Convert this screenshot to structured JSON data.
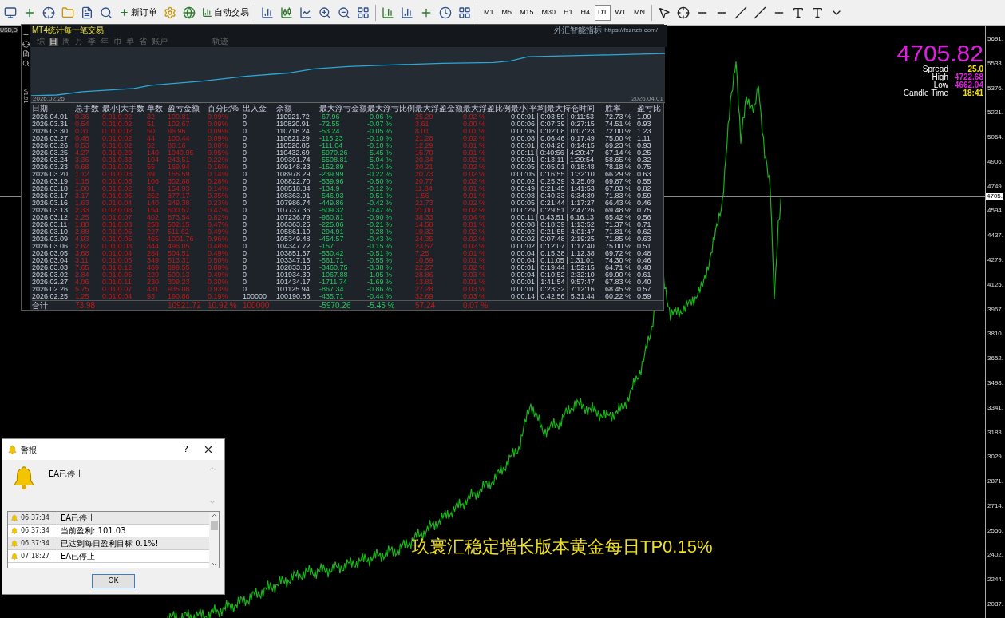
{
  "toolbar": {
    "new_order": "新订单",
    "auto_trading": "自动交易",
    "timeframes": [
      {
        "label": "M1",
        "selected": false
      },
      {
        "label": "M5",
        "selected": false
      },
      {
        "label": "M15",
        "selected": false
      },
      {
        "label": "M30",
        "selected": false
      },
      {
        "label": "H1",
        "selected": false
      },
      {
        "label": "H4",
        "selected": false
      },
      {
        "label": "D1",
        "selected": true
      },
      {
        "label": "W1",
        "selected": false
      },
      {
        "label": "MN",
        "selected": false
      }
    ]
  },
  "chart": {
    "symbol_tab": "USD,D",
    "price_labels": [
      "5691.",
      "5533.",
      "5376.",
      "5221.",
      "5064.",
      "4906.",
      "4749.",
      "4594.",
      "4437.",
      "4279.",
      "4125.",
      "3967.",
      "3810.",
      "3652.",
      "3498.",
      "3341.",
      "3183.",
      "3029.",
      "2871.",
      "2714.",
      "2556.",
      "2402.",
      "2244.",
      "2087."
    ],
    "current_price_label": "4705.",
    "price": "4705.82",
    "info": [
      {
        "label": "Spread",
        "value": "25.0",
        "color": "#f5e100"
      },
      {
        "label": "High",
        "value": "4722.68",
        "color": "#e020e0"
      },
      {
        "label": "Low",
        "value": "4662.04",
        "color": "#e020e0"
      },
      {
        "label": "Candle Time",
        "value": "18:41",
        "color": "#f5e100"
      }
    ],
    "caption": "玖寰汇稳定增长版本黄金每日TP0.15%"
  },
  "stats_panel": {
    "title": "MT4统计每一笔交易",
    "brand": "外汇智能指标",
    "url": "https://fxznzb.com/",
    "version": "V1.91",
    "tabs": [
      {
        "label": "综",
        "selected": false
      },
      {
        "label": "日",
        "selected": true
      },
      {
        "label": "周",
        "selected": false
      },
      {
        "label": "月",
        "selected": false
      },
      {
        "label": "季",
        "selected": false
      },
      {
        "label": "年",
        "selected": false
      },
      {
        "label": "币",
        "selected": false
      },
      {
        "label": "单",
        "selected": false
      },
      {
        "label": "省",
        "selected": false
      },
      {
        "label": "账户",
        "selected": false
      },
      {
        "label": "轨迹",
        "selected": false
      }
    ],
    "equity_start": "2026.02.25",
    "equity_end": "2026.04.01",
    "columns": [
      {
        "label": "日期",
        "kind": "plain"
      },
      {
        "label": "总手数",
        "kind": "red"
      },
      {
        "label": "最小|大手数",
        "kind": "red"
      },
      {
        "label": "单数",
        "kind": "red"
      },
      {
        "label": "盈亏金额",
        "kind": "red"
      },
      {
        "label": "百分比%",
        "kind": "red"
      },
      {
        "label": "出入金",
        "kind": "plain"
      },
      {
        "label": "余额",
        "kind": "plain"
      },
      {
        "label": "最大浮亏金额",
        "kind": "green"
      },
      {
        "label": "最大浮亏比例",
        "kind": "green"
      },
      {
        "label": "最大浮盈金额",
        "kind": "red"
      },
      {
        "label": "最大浮盈比例",
        "kind": "red"
      },
      {
        "label": "最小|平均|最大持仓时间",
        "kind": "plain"
      },
      {
        "label": "胜率",
        "kind": "plain"
      },
      {
        "label": "盈亏比",
        "kind": "plain"
      }
    ],
    "rows": [
      [
        "2026.04.01",
        "0.36",
        "0.01|0.02",
        "32",
        "100.81",
        "0.09%",
        "0",
        "110921.72",
        "-67.96",
        "-0.06 %",
        "25.29",
        "0.02 %",
        "0:00:01 | 0:03:59 | 0:11:53",
        "72.73 %",
        "1.09"
      ],
      [
        "2026.03.31",
        "0.54",
        "0.01|0.02",
        "51",
        "102.67",
        "0.09%",
        "0",
        "110820.91",
        "-72.55",
        "-0.07 %",
        "3.61",
        "0.00 %",
        "0:00:06 | 0:07:39 | 0:27:15",
        "74.51 %",
        "0.93"
      ],
      [
        "2026.03.30",
        "0.31",
        "0.01|0.02",
        "50",
        "96.96",
        "0.09%",
        "0",
        "110718.24",
        "-53.24",
        "-0.05 %",
        "8.01",
        "0.01 %",
        "0:00:06 | 0:02:08 | 0:07:23",
        "72.00 %",
        "1.23"
      ],
      [
        "2026.03.27",
        "0.48",
        "0.01|0.02",
        "44",
        "100.44",
        "0.09%",
        "0",
        "110621.29",
        "-115.23",
        "-0.10 %",
        "21.28",
        "0.02 %",
        "0:00:08 | 0:06:46 | 0:17:49",
        "75.00 %",
        "1.11"
      ],
      [
        "2026.03.26",
        "0.53",
        "0.01|0.02",
        "52",
        "88.16",
        "0.08%",
        "0",
        "110520.85",
        "-111.04",
        "-0.10 %",
        "12.29",
        "0.01 %",
        "0:00:01 | 0:04:26 | 0:14:15",
        "69.23 %",
        "0.93"
      ],
      [
        "2026.03.25",
        "4.27",
        "0.01|0.29",
        "140",
        "1040.95",
        "0.95%",
        "0",
        "110432.69",
        "-5970.26",
        "-5.45 %",
        "15.70",
        "0.01 %",
        "0:00:11 | 0:40:56 | 4:20:47",
        "67.14 %",
        "0.25"
      ],
      [
        "2026.03.24",
        "3.36",
        "0.01|0.33",
        "104",
        "243.51",
        "0.22%",
        "0",
        "109391.74",
        "-5508.81",
        "-5.04 %",
        "20.34",
        "0.02 %",
        "0:00:01 | 0:13:11 | 1:29:54",
        "58.65 %",
        "0.32"
      ],
      [
        "2026.03.23",
        "0.68",
        "0.01|0.02",
        "55",
        "169.94",
        "0.16%",
        "0",
        "109148.23",
        "-152.89",
        "-0.14 %",
        "20.21",
        "0.02 %",
        "0:00:05 | 0:05:01 | 0:18:48",
        "78.18 %",
        "0.75"
      ],
      [
        "2026.03.20",
        "1.12",
        "0.01|0.03",
        "89",
        "155.59",
        "0.14%",
        "0",
        "108978.29",
        "-239.99",
        "-0.22 %",
        "20.73",
        "0.02 %",
        "0:00:05 | 0:16:55 | 1:32:10",
        "66.29 %",
        "0.63"
      ],
      [
        "2026.03.19",
        "1.15",
        "0.01|0.05",
        "106",
        "302.88",
        "0.28%",
        "0",
        "108822.70",
        "-539.96",
        "-0.50 %",
        "20.77",
        "0.02 %",
        "0:00:02 | 0:25:39 | 3:25:09",
        "69.87 %",
        "0.55"
      ],
      [
        "2026.03.18",
        "1.00",
        "0.01|0.02",
        "91",
        "154.93",
        "0.14%",
        "0",
        "108518.84",
        "-134.9",
        "-0.12 %",
        "11.84",
        "0.01 %",
        "0:00:49 | 0:21:45 | 1:41:53",
        "67.03 %",
        "0.82"
      ],
      [
        "2026.03.17",
        "3.17",
        "0.01|0.05",
        "252",
        "377.17",
        "0.35%",
        "0",
        "108363.91",
        "-546.93",
        "-0.51 %",
        "1.56",
        "0.01 %",
        "0:00:08 | 0:40:33 | 6:34:39",
        "71.83 %",
        "0.59"
      ],
      [
        "2026.03.16",
        "1.63",
        "0.01|0.04",
        "140",
        "249.38",
        "0.23%",
        "0",
        "107986.74",
        "-449.86",
        "-0.42 %",
        "22.73",
        "0.02 %",
        "0:00:05 | 0:21:44 | 1:17:27",
        "66.43 %",
        "0.46"
      ],
      [
        "2026.03.13",
        "2.33",
        "0.02|0.08",
        "154",
        "500.57",
        "0.47%",
        "0",
        "107737.36",
        "-509.32",
        "-0.47 %",
        "21.00",
        "0.02 %",
        "0:00:29 | 0:29:51 | 2:47:26",
        "69.48 %",
        "0.75"
      ],
      [
        "2026.03.12",
        "2.25",
        "0.01|0.07",
        "402",
        "873.54",
        "0.82%",
        "0",
        "107236.79",
        "-960.81",
        "-0.90 %",
        "38.33",
        "0.04 %",
        "0:00:11 | 0:43:51 | 6:16:13",
        "65.42 %",
        "0.56"
      ],
      [
        "2026.03.11",
        "1.80",
        "0.01|0.03",
        "258",
        "502.15",
        "0.47%",
        "0",
        "106363.25",
        "-225.06",
        "-0.21 %",
        "14.58",
        "0.01 %",
        "0:00:08 | 0:18:39 | 1:13:52",
        "71.37 %",
        "0.71"
      ],
      [
        "2026.03.10",
        "2.88",
        "0.01|0.05",
        "227",
        "511.62",
        "0.49%",
        "0",
        "105861.10",
        "-294.91",
        "-0.28 %",
        "19.32",
        "0.02 %",
        "0:00:02 | 0:21:55 | 4:01:47",
        "71.81 %",
        "0.62"
      ],
      [
        "2026.03.09",
        "4.93",
        "0.01|0.05",
        "465",
        "1001.76",
        "0.96%",
        "0",
        "105349.48",
        "-454.57",
        "-0.43 %",
        "24.35",
        "0.02 %",
        "0:00:02 | 0:07:48 | 2:19:25",
        "71.85 %",
        "0.63"
      ],
      [
        "2026.03.06",
        "2.62",
        "0.01|0.03",
        "344",
        "496.05",
        "0.48%",
        "0",
        "104347.72",
        "-157",
        "-0.15 %",
        "23.57",
        "0.02 %",
        "0:00:02 | 0:12:07 | 1:17:40",
        "75.00 %",
        "0.51"
      ],
      [
        "2026.03.05",
        "3.68",
        "0.01|0.04",
        "284",
        "504.51",
        "0.49%",
        "0",
        "103851.67",
        "-530.42",
        "-0.51 %",
        "7.25",
        "0.01 %",
        "0:00:04 | 0:15:38 | 1:12:38",
        "69.72 %",
        "0.48"
      ],
      [
        "2026.03.04",
        "3.11",
        "0.01|0.05",
        "349",
        "513.31",
        "0.50%",
        "0",
        "103347.16",
        "-561.71",
        "-0.55 %",
        "10.59",
        "0.01 %",
        "0:00:04 | 0:11:05 | 1:31:01",
        "74.30 %",
        "0.46"
      ],
      [
        "2026.03.03",
        "7.65",
        "0.01|0.12",
        "469",
        "899.55",
        "0.88%",
        "0",
        "102833.85",
        "-3460.75",
        "-3.38 %",
        "22.27",
        "0.02 %",
        "0:00:01 | 0:19:44 | 1:52:15",
        "64.71 %",
        "0.40"
      ],
      [
        "2026.03.02",
        "2.84",
        "0.01|0.05",
        "229",
        "500.13",
        "0.49%",
        "0",
        "101934.30",
        "-1067.88",
        "-1.05 %",
        "28.86",
        "0.03 %",
        "0:00:04 | 0:10:52 | 2:32:10",
        "69.00 %",
        "0.61"
      ],
      [
        "2026.02.27",
        "4.06",
        "0.01|0.11",
        "230",
        "309.23",
        "0.30%",
        "0",
        "101434.17",
        "-1711.74",
        "-1.69 %",
        "13.81",
        "0.01 %",
        "0:00:01 | 1:41:54 | 9:57:47",
        "67.83 %",
        "0.40"
      ],
      [
        "2026.02.26",
        "5.75",
        "0.01|0.07",
        "431",
        "935.08",
        "0.93%",
        "0",
        "101125.94",
        "-867.34",
        "-0.86 %",
        "27.28",
        "0.03 %",
        "0:00:01 | 0:23:32 | 7:12:16",
        "68.45 %",
        "0.57"
      ],
      [
        "2026.02.25",
        "1.25",
        "0.01|0.04",
        "93",
        "190.86",
        "0.19%",
        "100000",
        "100190.86",
        "-435.71",
        "-0.44 %",
        "32.69",
        "0.03 %",
        "0:00:14 | 0:42:56 | 5:31:44",
        "60.22 %",
        "0.59"
      ]
    ],
    "total": {
      "label": "合计",
      "lots": "73.98",
      "pnl": "10921.72",
      "pct": "10.92 %",
      "deposit": "100000",
      "max_float_loss": "-5970.26",
      "max_float_loss_pct": "-5.45 %",
      "max_float_profit": "57.24",
      "max_float_profit_pct": "0.07 %"
    }
  },
  "alert": {
    "title": "警报",
    "help": "?",
    "message": "EA已停止",
    "entries": [
      {
        "time": "06:37:34",
        "text": "EA已停止"
      },
      {
        "time": "06:37:34",
        "text": "当前盈利: 101.03"
      },
      {
        "time": "06:37:34",
        "text": "已达到每日盈利目标 0.1%!"
      },
      {
        "time": "07:18:27",
        "text": "EA已停止"
      }
    ],
    "ok": "OK"
  }
}
